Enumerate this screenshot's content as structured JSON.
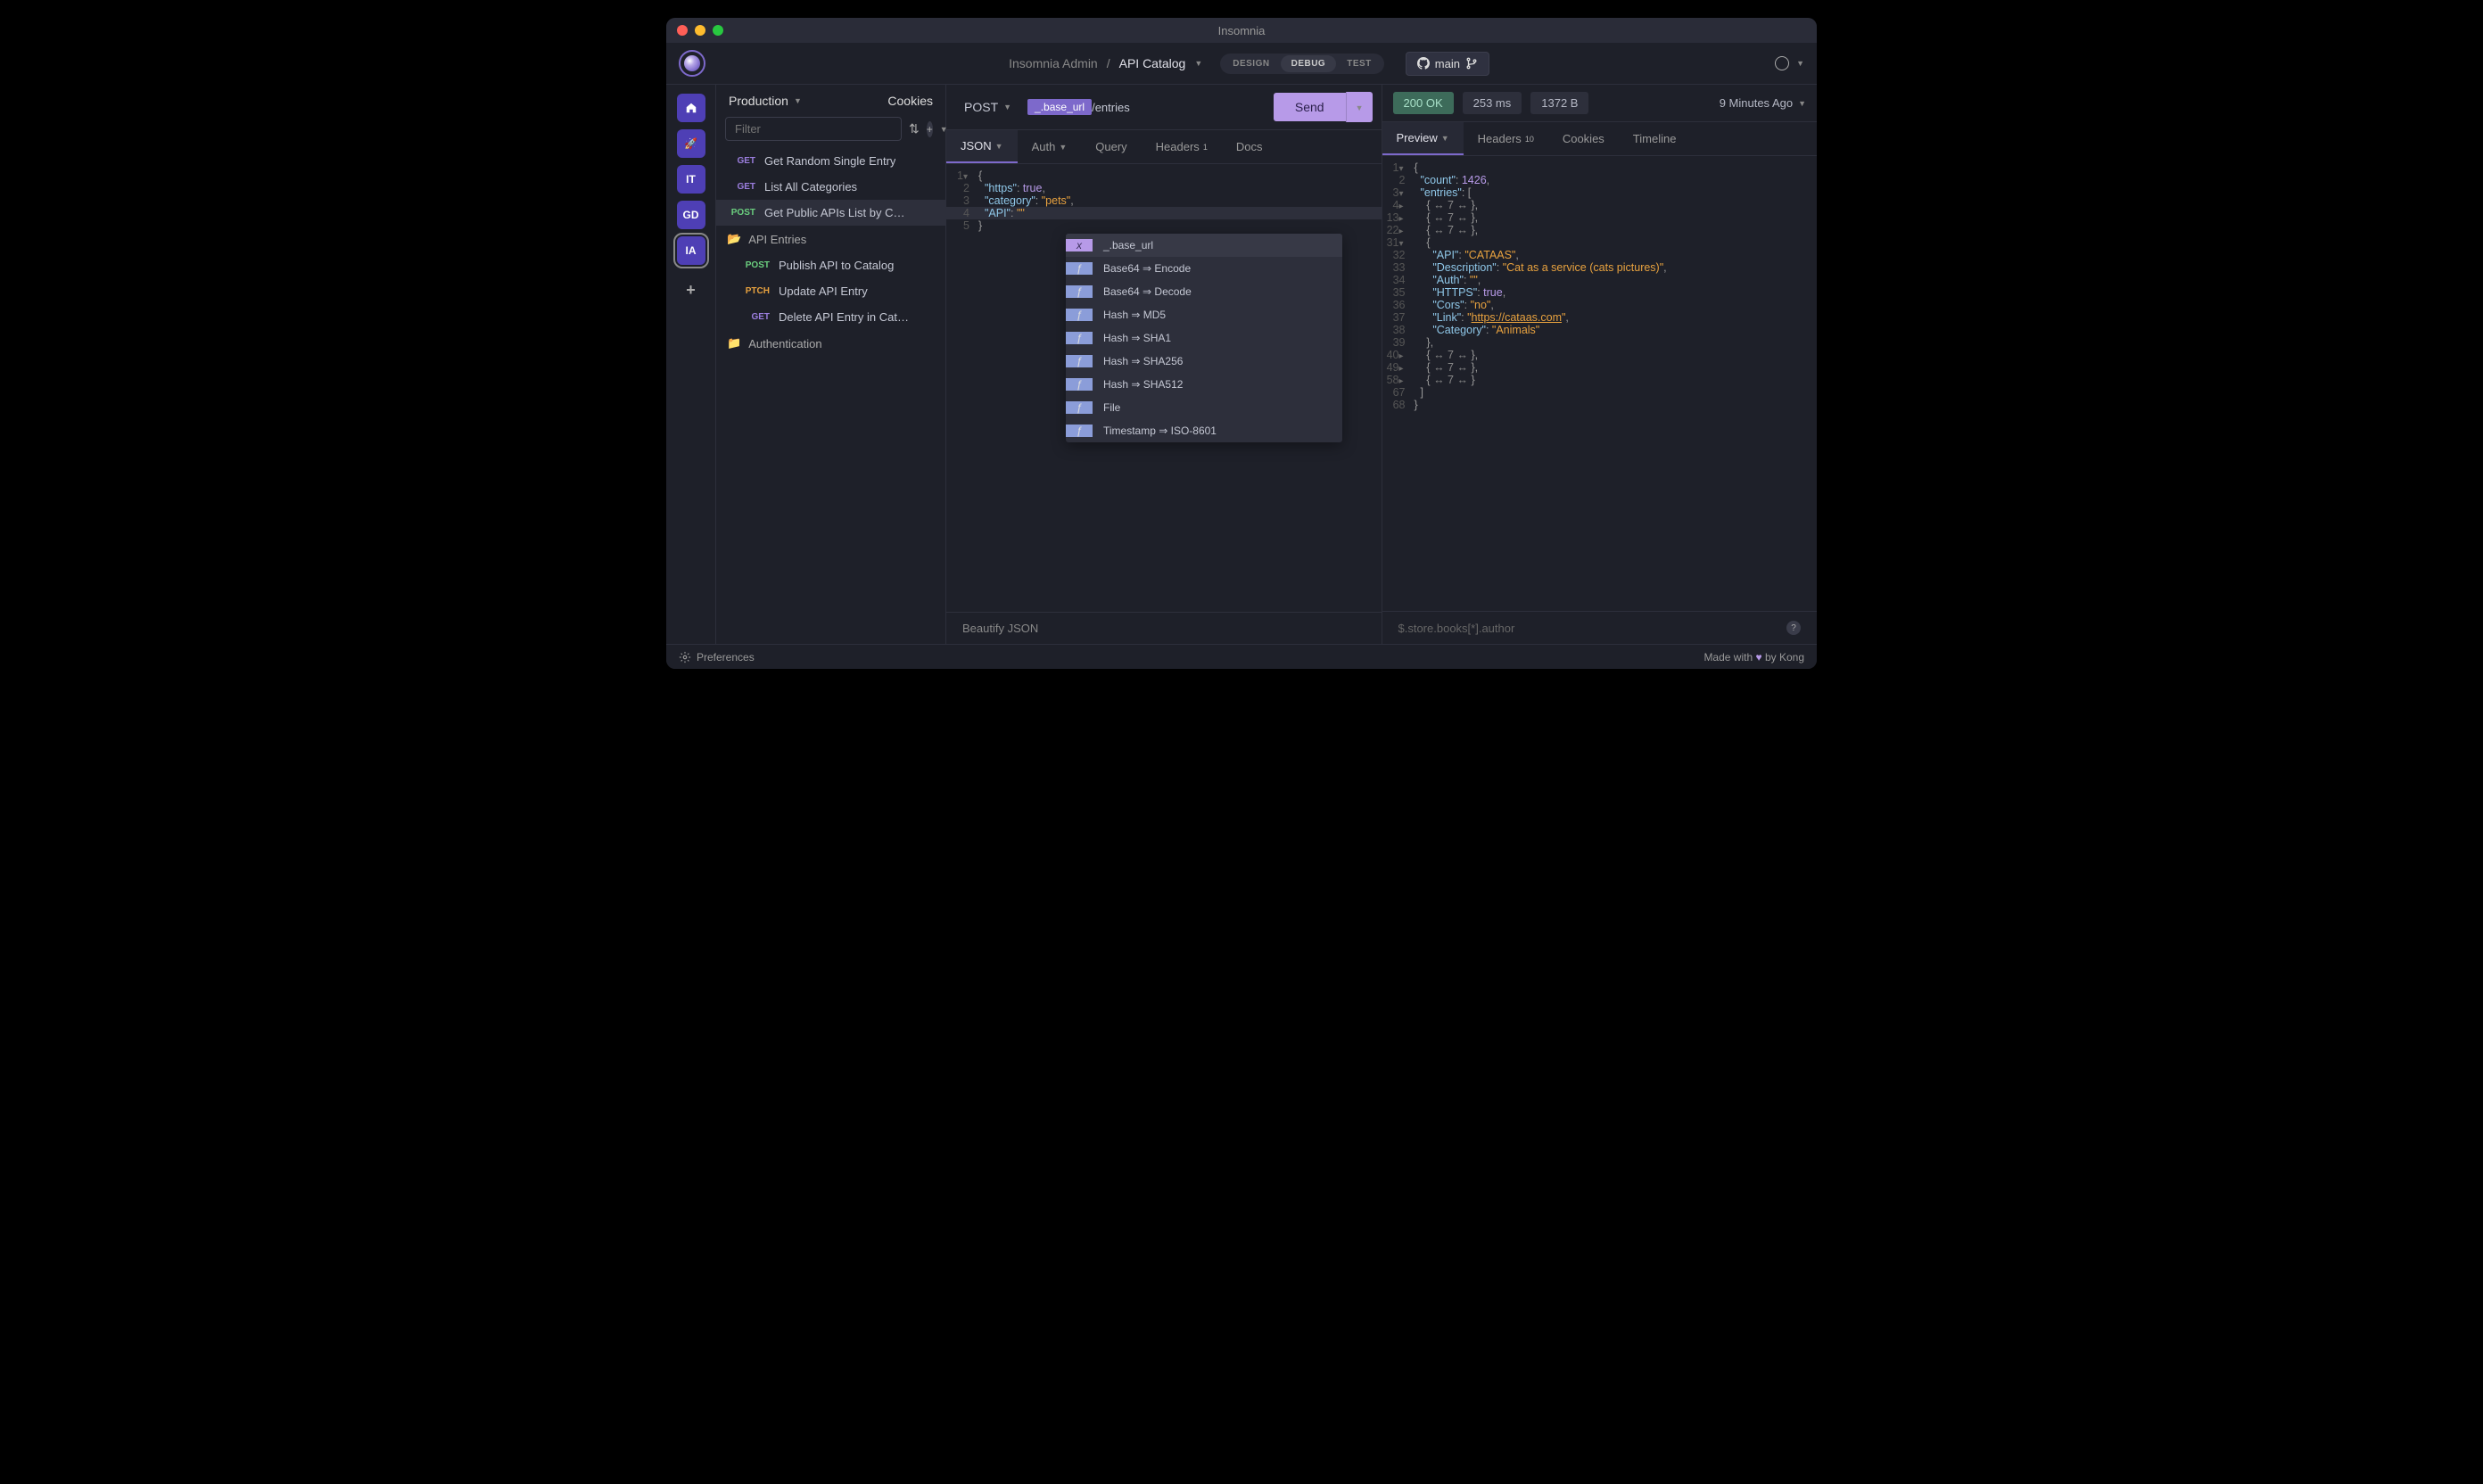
{
  "window": {
    "title": "Insomnia"
  },
  "breadcrumb": {
    "workspace": "Insomnia Admin",
    "project": "API Catalog"
  },
  "modes": {
    "design": "DESIGN",
    "debug": "DEBUG",
    "test": "TEST"
  },
  "branch": {
    "label": "main"
  },
  "sidebar": {
    "env": "Production",
    "cookies": "Cookies",
    "filter_placeholder": "Filter",
    "items": [
      {
        "method": "GET",
        "name": "Get Random Single Entry"
      },
      {
        "method": "GET",
        "name": "List All Categories"
      },
      {
        "method": "POST",
        "name": "Get Public APIs List by C…"
      }
    ],
    "folder1": "API Entries",
    "folder1_items": [
      {
        "method": "POST",
        "name": "Publish API to Catalog"
      },
      {
        "method": "PTCH",
        "name": "Update API Entry"
      },
      {
        "method": "GET",
        "name": "Delete API Entry in Cat…"
      }
    ],
    "folder2": "Authentication"
  },
  "request": {
    "method": "POST",
    "url_tag": "_.base_url",
    "url_path": "/entries",
    "send": "Send",
    "tabs": {
      "json": "JSON",
      "auth": "Auth",
      "query": "Query",
      "headers": "Headers",
      "headers_count": "1",
      "docs": "Docs"
    },
    "body_lines": {
      "l1": "{",
      "l2_key": "\"https\"",
      "l2_val": "true",
      "l3_key": "\"category\"",
      "l3_val": "\"pets\"",
      "l4_key": "\"API\"",
      "l4_val": "\"\"",
      "l5": "}"
    },
    "footer": "Beautify JSON"
  },
  "autocomplete": {
    "items": [
      {
        "badge": "x",
        "text": "_.base_url"
      },
      {
        "badge": "ƒ",
        "text": "Base64 ⇒ Encode"
      },
      {
        "badge": "ƒ",
        "text": "Base64 ⇒ Decode"
      },
      {
        "badge": "ƒ",
        "text": "Hash ⇒ MD5"
      },
      {
        "badge": "ƒ",
        "text": "Hash ⇒ SHA1"
      },
      {
        "badge": "ƒ",
        "text": "Hash ⇒ SHA256"
      },
      {
        "badge": "ƒ",
        "text": "Hash ⇒ SHA512"
      },
      {
        "badge": "ƒ",
        "text": "File"
      },
      {
        "badge": "ƒ",
        "text": "Timestamp ⇒ ISO-8601"
      }
    ]
  },
  "response": {
    "status_code": "200",
    "status_text": "OK",
    "time": "253 ms",
    "size": "1372 B",
    "ago": "9 Minutes Ago",
    "tabs": {
      "preview": "Preview",
      "headers": "Headers",
      "headers_count": "10",
      "cookies": "Cookies",
      "timeline": "Timeline"
    },
    "body": {
      "count": "1426",
      "fold_lines": [
        "4",
        "13",
        "22",
        "40",
        "49",
        "58"
      ],
      "fold_text": "↔ 7 ↔",
      "api_val": "\"CATAAS\"",
      "desc_val": "\"Cat as a service (cats pictures)\"",
      "auth_val": "\"\"",
      "https_val": "true",
      "cors_val": "\"no\"",
      "link_val": "https://cataas.com",
      "cat_val": "\"Animals\""
    },
    "filter_placeholder": "$.store.books[*].author"
  },
  "statusbar": {
    "prefs": "Preferences",
    "made": "Made with",
    "by": "by Kong"
  },
  "rail": {
    "it": "IT",
    "gd": "GD",
    "ia": "IA"
  }
}
